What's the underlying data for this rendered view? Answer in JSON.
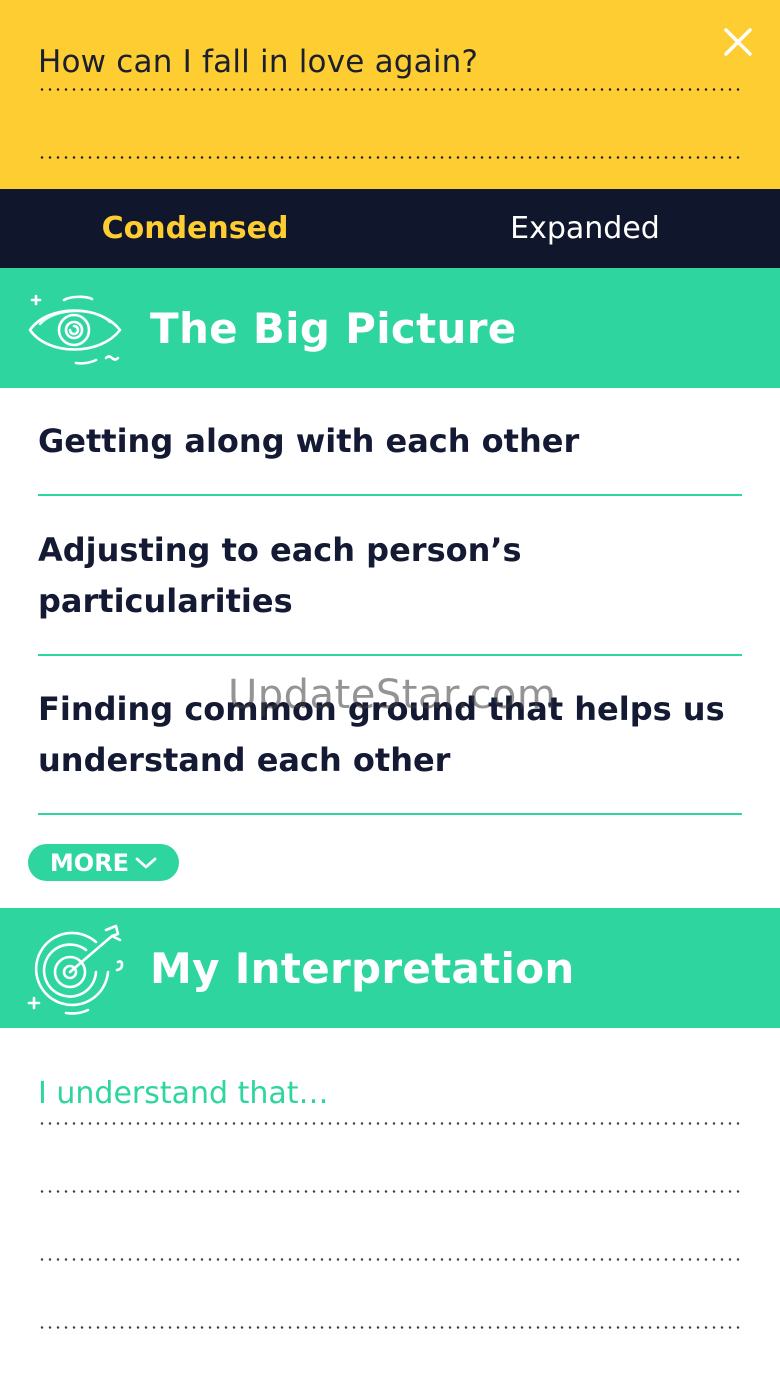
{
  "question": {
    "text": "How can I fall in love again?",
    "close_icon": "close-icon"
  },
  "tabs": [
    {
      "label": "Condensed",
      "active": true
    },
    {
      "label": "Expanded",
      "active": false
    }
  ],
  "big_picture": {
    "title": "The Big Picture",
    "icon": "eye-icon",
    "items": [
      {
        "text": "Getting along with each other"
      },
      {
        "text": "Adjusting to each person’s particularities"
      },
      {
        "text": "Finding common ground that helps us understand each other"
      }
    ],
    "more_label": "MORE",
    "more_icon": "chevron-down-icon"
  },
  "interpretation": {
    "title": "My Interpretation",
    "icon": "target-arrow-icon",
    "placeholder": "I understand that…"
  },
  "watermark": "UpdateStar.com",
  "colors": {
    "yellow": "#fecd32",
    "navy": "#10162b",
    "green": "#2fd59f",
    "text": "#141a33"
  }
}
